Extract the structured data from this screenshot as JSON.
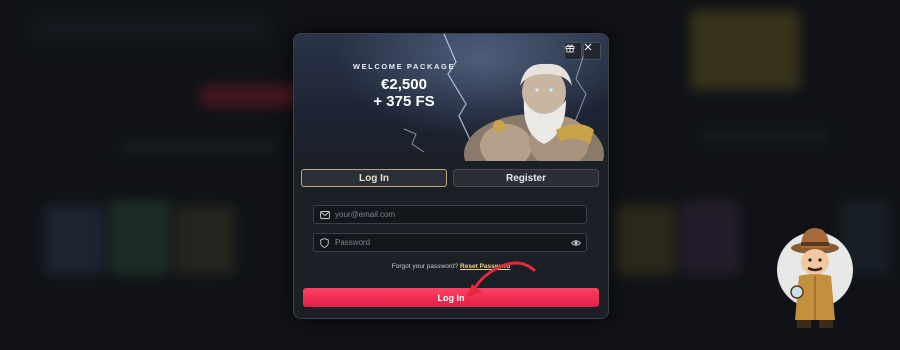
{
  "banner": {
    "welcome_label": "WELCOME PACKAGE",
    "amount_line1": "€2,500",
    "amount_line2": "+ 375 FS"
  },
  "header_icons": [
    "gift-icon",
    "close-icon"
  ],
  "tabs": {
    "login": "Log In",
    "register": "Register"
  },
  "form": {
    "email_placeholder": "your@email.com",
    "password_placeholder": "Password",
    "forgot_text": "Forgot your password?",
    "reset_link": "Reset Password"
  },
  "submit_label": "Log In",
  "colors": {
    "accent": "#ff3f63",
    "gold": "#f0d28a",
    "background": "#16191f",
    "modal": "#1b2027"
  }
}
